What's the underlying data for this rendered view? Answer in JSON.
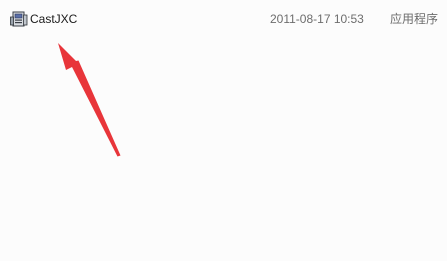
{
  "file": {
    "name": "CastJXC",
    "date_modified": "2011-08-17 10:53",
    "type": "应用程序",
    "icon": "application-icon"
  },
  "annotation": {
    "arrow_color": "#e8353a"
  }
}
